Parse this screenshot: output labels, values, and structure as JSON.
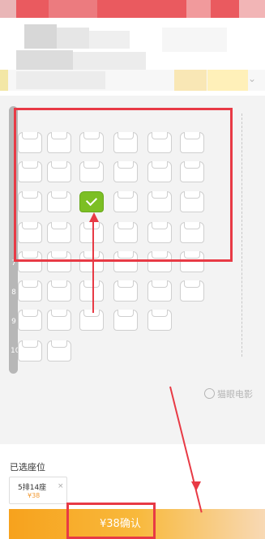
{
  "seat_map": {
    "row_numbers": [
      "7",
      "8",
      "9",
      "10"
    ],
    "selected_seat": "5排14座",
    "watermark": "猫眼电影"
  },
  "selected_section": {
    "title": "已选座位",
    "ticket": {
      "seat": "5排14座",
      "price": "¥38",
      "remove": "×"
    }
  },
  "confirm": {
    "label": "¥38确认"
  },
  "colors": {
    "header_red": "#ea5a5f",
    "selected_seat": "#7cbf24",
    "confirm_orange": "#f7a21d",
    "annotation_red": "#e83a45"
  }
}
